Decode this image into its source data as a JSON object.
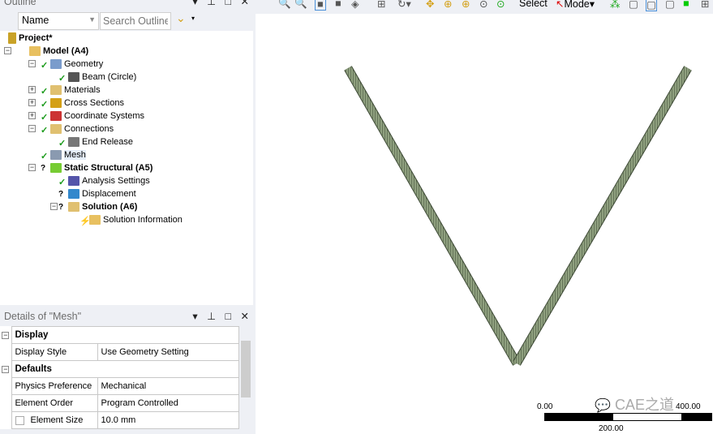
{
  "outline": {
    "title": "Outline",
    "filter_select": "Name",
    "search_placeholder": "Search Outline",
    "tree": [
      {
        "label": "Project*",
        "bold": true,
        "depth": 0
      },
      {
        "label": "Model (A4)",
        "bold": true,
        "depth": 1
      },
      {
        "label": "Geometry",
        "depth": 2,
        "status": "ok"
      },
      {
        "label": "Beam (Circle)",
        "depth": 3,
        "status": "ok"
      },
      {
        "label": "Materials",
        "depth": 2,
        "status": "ok"
      },
      {
        "label": "Cross Sections",
        "depth": 2,
        "status": "ok"
      },
      {
        "label": "Coordinate Systems",
        "depth": 2,
        "status": "ok"
      },
      {
        "label": "Connections",
        "depth": 2,
        "status": "ok"
      },
      {
        "label": "End Release",
        "depth": 3,
        "status": "ok"
      },
      {
        "label": "Mesh",
        "depth": 2,
        "status": "ok",
        "selected": true
      },
      {
        "label": "Static Structural (A5)",
        "bold": true,
        "depth": 2,
        "status": "?"
      },
      {
        "label": "Analysis Settings",
        "depth": 3,
        "status": "ok"
      },
      {
        "label": "Displacement",
        "depth": 3,
        "status": "?"
      },
      {
        "label": "Solution (A6)",
        "bold": true,
        "depth": 3,
        "status": "?"
      },
      {
        "label": "Solution Information",
        "depth": 4,
        "status": "lightning"
      }
    ]
  },
  "details": {
    "title": "Details of \"Mesh\"",
    "groups": [
      {
        "name": "Display",
        "rows": [
          {
            "k": "Display Style",
            "v": "Use Geometry Setting"
          }
        ]
      },
      {
        "name": "Defaults",
        "rows": [
          {
            "k": "Physics Preference",
            "v": "Mechanical"
          },
          {
            "k": "Element Order",
            "v": "Program Controlled"
          },
          {
            "k": "Element Size",
            "v": "10.0 mm"
          }
        ]
      }
    ]
  },
  "toolbar": {
    "select_label": "Select",
    "mode_label": "Mode"
  },
  "viewport": {
    "scale_start": "0.00",
    "scale_mid": "200.00",
    "scale_end": "400.00",
    "watermark": "CAE之道",
    "mesh_color": "#5d6e52"
  }
}
